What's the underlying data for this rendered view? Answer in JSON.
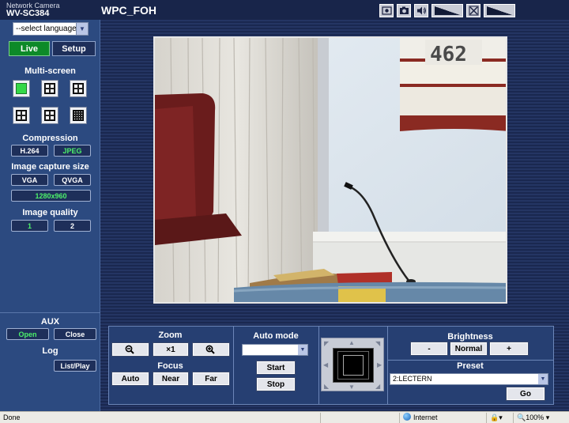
{
  "header": {
    "brand_line1": "Network Camera",
    "brand_line2": "WV-SC384",
    "camera_title": "WPC_FOH",
    "icons": [
      "snapshot-icon",
      "camera-icon",
      "speaker-icon",
      "volume-level",
      "mic-mute-icon",
      "mic-level"
    ]
  },
  "sidebar": {
    "language": "--select language--",
    "tabs": {
      "live": "Live",
      "setup": "Setup"
    },
    "multiscreen_title": "Multi-screen",
    "compression_title": "Compression",
    "compression": {
      "h264": "H.264",
      "jpeg": "JPEG"
    },
    "capture_title": "Image capture size",
    "capture": {
      "vga": "VGA",
      "qvga": "QVGA",
      "hd": "1280x960"
    },
    "quality_title": "Image quality",
    "quality": {
      "q1": "1",
      "q2": "2"
    },
    "aux_title": "AUX",
    "aux": {
      "open": "Open",
      "close": "Close"
    },
    "log_title": "Log",
    "log_button": "List/Play"
  },
  "video": {
    "room_number": "462"
  },
  "controls": {
    "zoom_title": "Zoom",
    "zoom_reset": "×1",
    "focus_title": "Focus",
    "focus": {
      "auto": "Auto",
      "near": "Near",
      "far": "Far"
    },
    "automode_title": "Auto mode",
    "automode_value": "",
    "start": "Start",
    "stop": "Stop",
    "brightness_title": "Brightness",
    "brightness": {
      "minus": "-",
      "normal": "Normal",
      "plus": "+"
    },
    "preset_title": "Preset",
    "preset_value": "2:LECTERN",
    "go": "Go"
  },
  "statusbar": {
    "status": "Done",
    "zone": "Internet",
    "zoom": "100%"
  }
}
